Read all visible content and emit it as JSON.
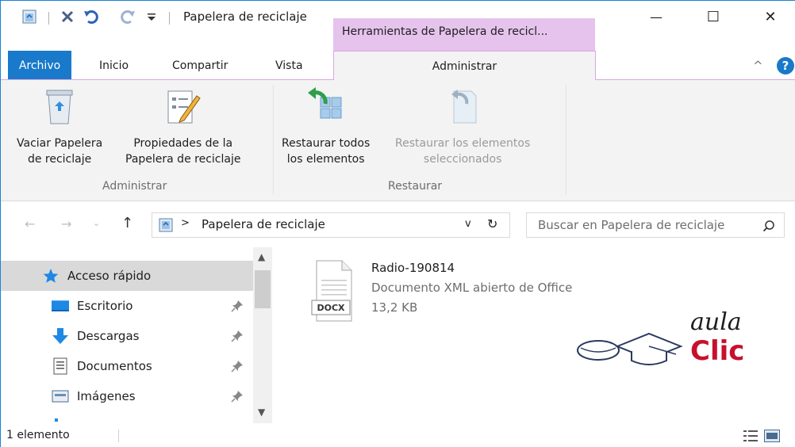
{
  "window": {
    "title": "Papelera de reciclaje",
    "context_tab_title": "Herramientas de Papelera de recicl...",
    "caption": {
      "minimize": "—",
      "maximize": "☐",
      "close": "✕"
    }
  },
  "quick_access": {
    "icons": [
      "recycle-bin-icon",
      "delete-icon",
      "undo-icon",
      "redo-icon",
      "customize-dropdown-icon"
    ]
  },
  "tabs": {
    "file": "Archivo",
    "home": "Inicio",
    "share": "Compartir",
    "view": "Vista",
    "manage": "Administrar",
    "collapse_glyph": "^",
    "help_glyph": "?"
  },
  "ribbon": {
    "groups": [
      {
        "label": "Administrar",
        "buttons": [
          {
            "line1": "Vaciar Papelera",
            "line2": "de reciclaje",
            "icon": "empty-recycle-bin-icon",
            "enabled": true
          },
          {
            "line1": "Propiedades de la",
            "line2": "Papelera de reciclaje",
            "icon": "recycle-bin-properties-icon",
            "enabled": true
          }
        ]
      },
      {
        "label": "Restaurar",
        "buttons": [
          {
            "line1": "Restaurar todos",
            "line2": "los elementos",
            "icon": "restore-all-icon",
            "enabled": true
          },
          {
            "line1": "Restaurar los elementos",
            "line2": "seleccionados",
            "icon": "restore-selected-icon",
            "enabled": false
          }
        ]
      }
    ]
  },
  "address": {
    "path_separator": ">",
    "path": "Papelera de reciclaje",
    "dropdown_glyph": "v",
    "refresh_glyph": "↻",
    "search_placeholder": "Buscar en Papelera de reciclaje"
  },
  "nav": {
    "items": [
      {
        "label": "Acceso rápido",
        "icon": "quick-access-star-icon",
        "selected": true,
        "pinned": false
      },
      {
        "label": "Escritorio",
        "icon": "desktop-icon",
        "selected": false,
        "pinned": true
      },
      {
        "label": "Descargas",
        "icon": "downloads-icon",
        "selected": false,
        "pinned": true
      },
      {
        "label": "Documentos",
        "icon": "documents-icon",
        "selected": false,
        "pinned": true
      },
      {
        "label": "Imágenes",
        "icon": "pictures-icon",
        "selected": false,
        "pinned": true
      }
    ]
  },
  "content": {
    "files": [
      {
        "name": "Radio-190814",
        "type": "Documento XML abierto de Office",
        "size": "13,2 KB",
        "badge": "DOCX"
      }
    ]
  },
  "watermark": {
    "line1": "aula",
    "line2": "Clic"
  },
  "status": {
    "count": "1 elemento"
  },
  "colors": {
    "accent": "#1979ca",
    "context": "#e6c3ed",
    "ribbon_bg": "#f3f3f3",
    "logo_red": "#c8102e"
  }
}
